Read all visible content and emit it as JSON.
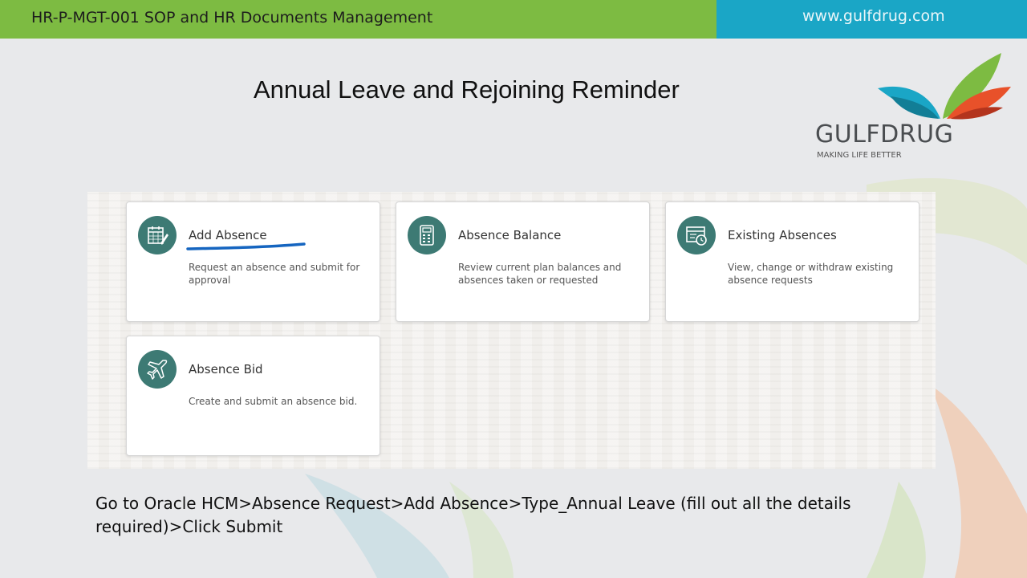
{
  "header": {
    "title": "HR-P-MGT-001 SOP and HR Documents Management",
    "website": "www.gulfdrug.com",
    "colors": {
      "green": "#7dbb42",
      "blue": "#1aa6c6"
    }
  },
  "slide": {
    "title": "Annual Leave and Rejoining Reminder",
    "instruction": "Go to Oracle HCM>Absence Request>Add Absence>Type_Annual Leave (fill out all the details required)>Click Submit"
  },
  "logo": {
    "name": "GULFDRUG",
    "tagline": "MAKING LIFE BETTER"
  },
  "cards": [
    {
      "title": "Add Absence",
      "description": "Request an absence and submit for approval",
      "icon": "calendar-edit-icon"
    },
    {
      "title": "Absence Balance",
      "description": "Review current plan balances and absences taken or requested",
      "icon": "calculator-icon"
    },
    {
      "title": "Existing Absences",
      "description": "View, change or withdraw existing absence requests",
      "icon": "calendar-clock-icon"
    },
    {
      "title": "Absence Bid",
      "description": "Create and submit an absence bid.",
      "icon": "airplane-icon"
    }
  ],
  "accent": {
    "icon_bg": "#3d7a74",
    "underline": "#1565c0"
  }
}
